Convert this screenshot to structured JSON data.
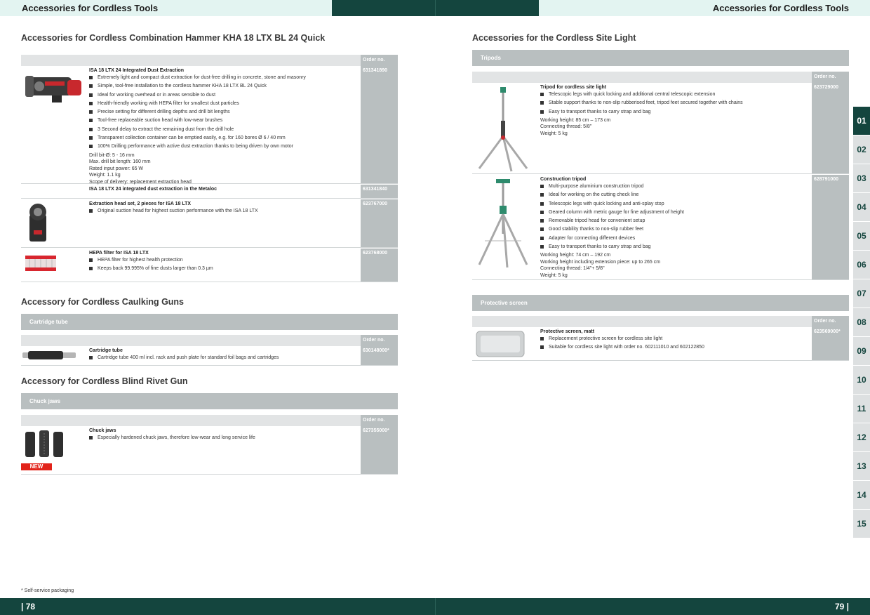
{
  "header": {
    "left_title": "Accessories for Cordless Tools",
    "right_title": "Accessories for Cordless Tools"
  },
  "footer": {
    "left_page": "| 78",
    "right_page": "79 |",
    "footnote": "* Self-service packaging"
  },
  "order_label": "Order no.",
  "colors": {
    "brand_dark": "#14453e",
    "light_mint": "#e3f4f1",
    "grey_bar": "#b9bfc0",
    "new_badge": "#e2231a"
  },
  "side_tabs": [
    "01",
    "02",
    "03",
    "04",
    "05",
    "06",
    "07",
    "08",
    "09",
    "10",
    "11",
    "12",
    "13",
    "14",
    "15"
  ],
  "sections": {
    "hammer": {
      "title": "Accessories for Cordless Combination Hammer KHA 18 LTX BL 24 Quick",
      "items": [
        {
          "name": "ISA 18 LTX 24 Integrated Dust Extraction",
          "order": "631341890",
          "bullets": [
            "Extremely light and compact dust extraction for dust-free drilling in concrete, stone and masonry",
            "Simple, tool-free installation to the cordless hammer KHA 18 LTX BL 24 Quick",
            "Ideal for working overhead or in areas sensible to dust",
            "Health-friendly working with HEPA filter for smallest dust particles",
            "Precise setting for different drilling depths and drill bit lengths",
            "Tool-free replaceable suction head with low-wear brushes",
            "3 Second delay to extract the remaining dust from the drill hole",
            "Transparent collection container can be emptied easily, e.g. for 160 bores Ø 6 / 40 mm",
            "100% Drilling performance with active dust extraction thanks to being driven by own motor"
          ],
          "specs": [
            "Drill bit-Ø: 5 - 16 mm",
            "Max. drill bit length: 160 mm",
            "Rated input power: 65 W",
            "Weight: 1.1 kg",
            "Scope of delivery: replacement extraction head"
          ]
        },
        {
          "name": "ISA 18 LTX 24 integrated dust extraction in the Metaloc",
          "order": "631341840"
        },
        {
          "name": "Extraction head set, 2 pieces for ISA 18 LTX",
          "order": "623767000",
          "bullets": [
            "Original suction head for highest suction performance with the ISA 18 LTX"
          ]
        },
        {
          "name": "HEPA filter for ISA 18 LTX",
          "order": "623768000",
          "bullets": [
            "HEPA filter for highest health protection",
            "Keeps back 99.995% of fine dusts larger than 0.3 µm"
          ]
        }
      ]
    },
    "caulking": {
      "title": "Accessory for Cordless Caulking Guns",
      "category": "Cartridge tube",
      "item": {
        "name": "Cartridge tube",
        "order": "630148000*",
        "bullets": [
          "Cartridge tube 400 ml incl. rack and push plate for standard foil bags and cartridges"
        ]
      }
    },
    "rivet": {
      "title": "Accessory for Cordless Blind Rivet Gun",
      "category": "Chuck jaws",
      "item": {
        "name": "Chuck jaws",
        "order": "627355000*",
        "bullets": [
          "Especially hardened chuck jaws, therefore low-wear and long service life"
        ]
      },
      "badge": "NEW"
    },
    "site_light": {
      "title": "Accessories for the Cordless Site Light",
      "category": "Tripods",
      "items": [
        {
          "name": "Tripod for cordless site light",
          "order": "623729000",
          "bullets": [
            "Telescopic legs with quick locking and additional central telescopic extension",
            "Stable support thanks to non-slip rubberised feet, tripod feet secured together with chains",
            "Easy to transport thanks to carry strap and bag"
          ],
          "specs": [
            "Working height: 85 cm – 173 cm",
            "Connecting thread: 5/8\"",
            "Weight: 5 kg"
          ]
        },
        {
          "name": "Construction tripod",
          "order": "628791000",
          "bullets": [
            "Multi-purpose aluminium construction tripod",
            "Ideal for working on the cutting check line",
            "Telescopic legs with quick locking and anti-splay stop",
            "Geared column with metric gauge for fine adjustment of height",
            "Removable tripod head for convenient setup",
            "Good stability thanks to non-slip rubber feet",
            "Adapter for connecting different devices",
            "Easy to transport thanks to carry strap and bag"
          ],
          "specs": [
            "Working height: 74 cm – 192 cm",
            "Working height including extension piece: up to 265 cm",
            "Connecting thread: 1/4\"+ 5/8\"",
            "Weight: 5 kg"
          ]
        }
      ]
    },
    "screen": {
      "category": "Protective screen",
      "item": {
        "name": "Protective screen, matt",
        "order": "623569000*",
        "bullets": [
          "Replacement protective screen for cordless site light",
          "Suitable for cordless site light with order no. 602111010 and 602122850"
        ]
      }
    }
  }
}
